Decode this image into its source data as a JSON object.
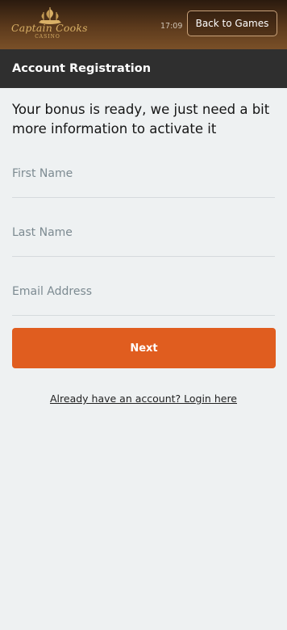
{
  "topbar": {
    "logo_text": "Captain Cooks",
    "logo_subtext": "CASINO",
    "time": "17:09",
    "back_button_label": "Back to Games"
  },
  "header": {
    "title": "Account Registration"
  },
  "form": {
    "intro_text": "Your bonus is ready, we just need a bit more information to activate it",
    "first_name": {
      "placeholder": "First Name",
      "value": ""
    },
    "last_name": {
      "placeholder": "Last Name",
      "value": ""
    },
    "email": {
      "placeholder": "Email Address",
      "value": ""
    },
    "next_label": "Next",
    "login_link_text": "Already have an account? Login here"
  },
  "colors": {
    "accent": "#e05d1f",
    "header_bg": "#2f2f2f",
    "page_bg": "#eef1f2"
  }
}
